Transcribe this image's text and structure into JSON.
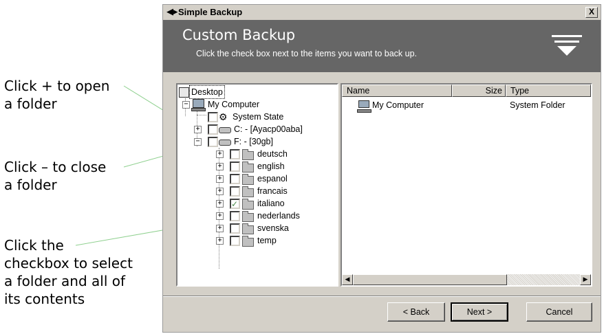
{
  "callouts": {
    "open": [
      "Click + to open",
      "a folder"
    ],
    "close": [
      "Click – to close",
      "a folder"
    ],
    "select": [
      "Click the",
      "checkbox to select",
      "a folder and all of",
      "its contents"
    ]
  },
  "window": {
    "title": "Simple Backup",
    "close_glyph": "X",
    "header_title": "Custom Backup",
    "header_subtitle": "Click the check box next to the items you want to back up."
  },
  "tree": {
    "desktop": "Desktop",
    "my_computer": "My Computer",
    "system_state": "System State",
    "drive_c": "C: - [Ayacp00aba]",
    "drive_f": "F: - [30gb]",
    "folders": [
      {
        "label": "deutsch",
        "checked": false
      },
      {
        "label": "english",
        "checked": false
      },
      {
        "label": "espanol",
        "checked": false
      },
      {
        "label": "francais",
        "checked": false
      },
      {
        "label": "italiano",
        "checked": true
      },
      {
        "label": "nederlands",
        "checked": false
      },
      {
        "label": "svenska",
        "checked": false
      },
      {
        "label": "temp",
        "checked": false
      }
    ]
  },
  "list": {
    "columns": {
      "name": "Name",
      "size": "Size",
      "type": "Type"
    },
    "rows": [
      {
        "name": "My Computer",
        "size": "",
        "type": "System Folder"
      }
    ]
  },
  "buttons": {
    "back": "< Back",
    "next": "Next >",
    "cancel": "Cancel"
  },
  "colors": {
    "header_bg": "#666666",
    "chrome": "#d4d0c8",
    "callout_line": "#8fd08f"
  }
}
